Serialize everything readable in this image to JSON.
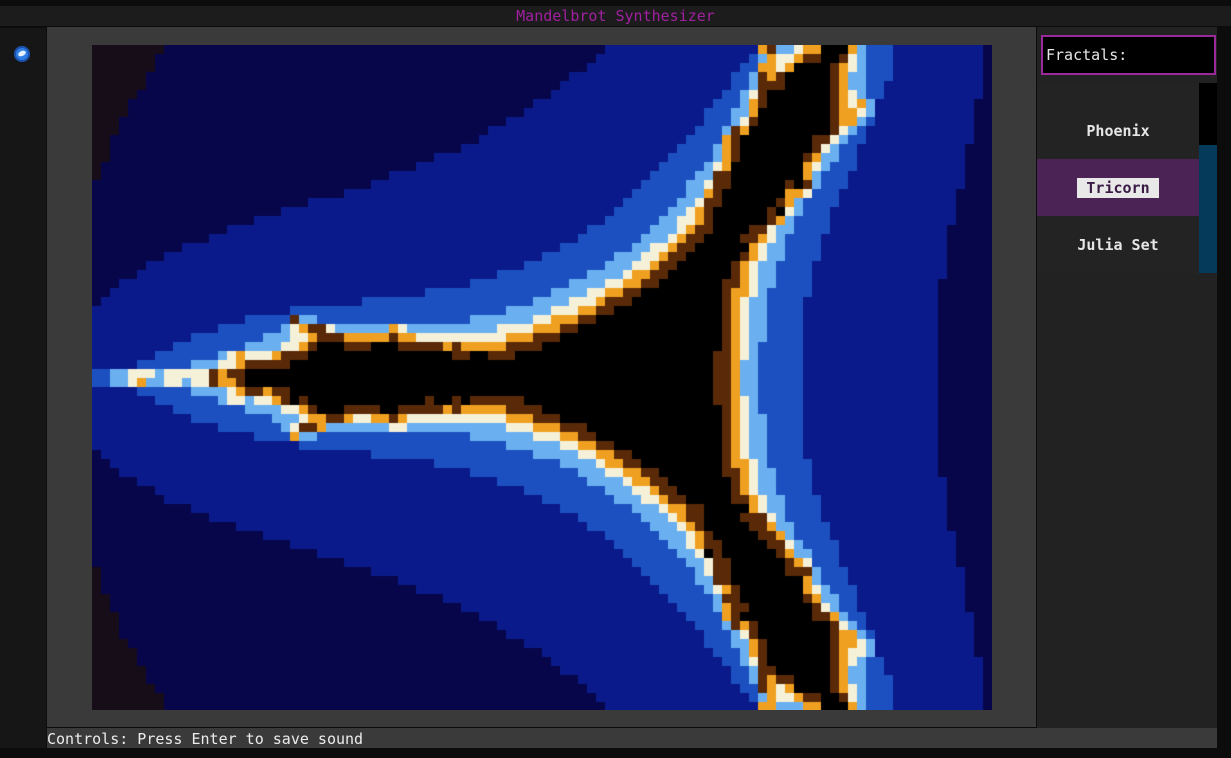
{
  "window": {
    "title": "Mandelbrot Synthesizer",
    "title_color": "#a020a0"
  },
  "sidebar": {
    "header": "Fractals:",
    "items": [
      {
        "label": "Phoenix",
        "selected": false
      },
      {
        "label": "Tricorn",
        "selected": true
      },
      {
        "label": "Julia Set",
        "selected": false
      }
    ],
    "accent_color": "#9a2a9a",
    "selected_color": "#4b2355"
  },
  "footer": {
    "controls": "Controls: Press Enter to save sound"
  },
  "viewer": {
    "fractal": "tricorn",
    "palette": [
      "#170d19",
      "#07064a",
      "#0a1a8a",
      "#1c50c0",
      "#6ab0f0",
      "#f5f0d8",
      "#f0a020",
      "#5a2a08",
      "#000000"
    ]
  }
}
